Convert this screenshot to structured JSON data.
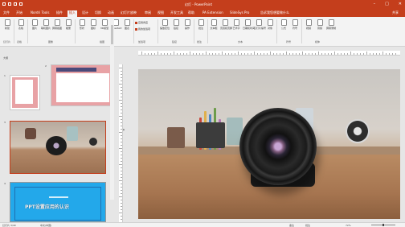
{
  "window": {
    "title": "幻灯 - PowerPoint",
    "min_icon": "minimize-icon",
    "max_icon": "restore-icon",
    "close_icon": "close-icon"
  },
  "tabs": [
    {
      "label": "文件"
    },
    {
      "label": "开始"
    },
    {
      "label": "Nordri Tools"
    },
    {
      "label": "插件"
    },
    {
      "label": "插入"
    },
    {
      "label": "设计"
    },
    {
      "label": "切换"
    },
    {
      "label": "动画"
    },
    {
      "label": "幻灯片放映"
    },
    {
      "label": "审阅"
    },
    {
      "label": "视图"
    },
    {
      "label": "开发工具"
    },
    {
      "label": "帮助"
    },
    {
      "label": "PA Extension"
    },
    {
      "label": "SlideSys Pro"
    },
    {
      "label": "告诉我您想要做什么"
    }
  ],
  "share": "共享",
  "ribbon": {
    "buttons": [
      "新建",
      "表格",
      "图片",
      "联机图片",
      "屏幕截图",
      "相册",
      "形状",
      "图标",
      "3D模型",
      "SmartArt",
      "图表"
    ],
    "small_items": [
      "应用商店",
      "我的加载项"
    ],
    "right_buttons": [
      "缩放定位",
      "链接",
      "操作",
      "批注",
      "文本框",
      "页眉和页脚",
      "艺术字",
      "日期和时间",
      "幻灯片编号",
      "对象",
      "公式",
      "符号",
      "视频",
      "音频",
      "屏幕录制"
    ],
    "groups": [
      "幻灯片",
      "表格",
      "图像",
      "插图",
      "加载项",
      "链接",
      "批注",
      "文本",
      "符号",
      "媒体"
    ]
  },
  "sidebar": {
    "header": "大纲",
    "slides": [
      {
        "num": "1"
      },
      {
        "num": "2"
      },
      {
        "num": "3"
      },
      {
        "num": "4",
        "headline": "PPT设置应用的认识"
      }
    ]
  },
  "status": {
    "slide": "幻灯片 3/40",
    "lang": "中文(中国)",
    "notes": "备注",
    "comments": "批注",
    "zoom": "72%"
  },
  "colors": {
    "accent": "#c43e1c",
    "ribbon_bg": "#f3f3f3",
    "thumb_blue": "#23a8ea",
    "thumb_pink": "#e8a2a5"
  }
}
